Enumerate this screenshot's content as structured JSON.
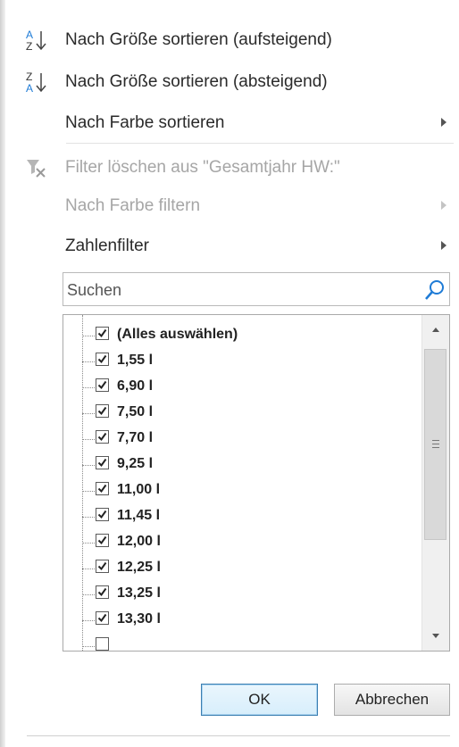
{
  "menu": {
    "sort_asc": "Nach Größe sortieren (aufsteigend)",
    "sort_desc": "Nach Größe sortieren (absteigend)",
    "sort_by_color": "Nach Farbe sortieren",
    "clear_filter": "Filter löschen aus \"Gesamtjahr HW:\"",
    "filter_by_color": "Nach Farbe filtern",
    "number_filters": "Zahlenfilter"
  },
  "search": {
    "placeholder": "Suchen"
  },
  "list": {
    "select_all": "(Alles auswählen)",
    "items": [
      "1,55 l",
      "6,90 l",
      "7,50 l",
      "7,70 l",
      "9,25 l",
      "11,00 l",
      "11,45 l",
      "12,00 l",
      "12,25 l",
      "13,25 l",
      "13,30 l"
    ]
  },
  "buttons": {
    "ok": "OK",
    "cancel": "Abbrechen"
  },
  "icons": {
    "sort_asc": "sort-ascending-icon",
    "sort_desc": "sort-descending-icon",
    "clear_filter": "clear-filter-icon",
    "search": "magnifier-icon"
  },
  "colors": {
    "accent": "#1e7bd6",
    "disabled_text": "#a6a6a6"
  }
}
